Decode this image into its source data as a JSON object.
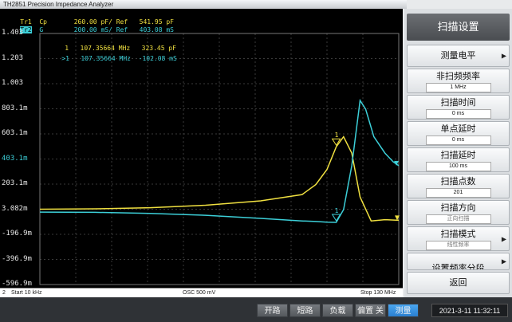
{
  "app": {
    "title": "TH2851 Precision Impedance Analyzer"
  },
  "traces": {
    "tr1": {
      "name": "Tr1",
      "param": "Cp",
      "value": "260.00",
      "unit": "pF/",
      "ref_label": "Ref",
      "ref": "541.95 pF",
      "color": "#f0e040"
    },
    "tr2": {
      "name": "Tr2",
      "param": "G",
      "value": "200.00",
      "unit": "mS/",
      "ref_label": "Ref",
      "ref": "403.08 mS",
      "color": "#3ccfd8"
    }
  },
  "markers": {
    "m1": {
      "id": "1",
      "freq": "107.35664 MHz",
      "value": "323.45 pF"
    },
    "m2": {
      "id": ">1",
      "freq": "107.35664 MHz",
      "value": "-102.08 mS"
    }
  },
  "y_labels": [
    "1.403",
    "1.203",
    "1.003",
    "803.1m",
    "603.1m",
    "403.1m",
    "203.1m",
    "3.082m",
    "-196.9m",
    "-396.9m",
    "-596.9m"
  ],
  "status": {
    "channel": "2",
    "start": "Start 10 kHz",
    "osc": "OSC 500 mV",
    "stop": "Stop 130 MHz"
  },
  "sidebar": {
    "title": "扫描设置",
    "items": [
      {
        "label": "测量电平",
        "value": null
      },
      {
        "label": "非扫频频率",
        "value": "1 MHz"
      },
      {
        "label": "扫描时间",
        "value": "0 ms"
      },
      {
        "label": "单点延时",
        "value": "0 ms"
      },
      {
        "label": "扫描延时",
        "value": "100 ms"
      },
      {
        "label": "扫描点数",
        "value": "201"
      },
      {
        "label": "扫描方向",
        "value": "正向扫描"
      },
      {
        "label": "扫描模式",
        "value": "线性频率"
      },
      {
        "label": "设置频率分段",
        "value": null
      },
      {
        "label": "返回",
        "value": null
      }
    ]
  },
  "bottom": {
    "buttons": [
      "开路",
      "短路",
      "负载",
      "偏置 关",
      "测量"
    ],
    "active": "测量",
    "datetime": "2021-3-11 11:32:11"
  },
  "chart_data": {
    "type": "line",
    "x_range_mhz": [
      0.01,
      130
    ],
    "ylim": [
      -0.5969,
      1.403
    ],
    "series": [
      {
        "name": "Tr1",
        "x": [
          0.01,
          20,
          40,
          60,
          80,
          95,
          100,
          104,
          107.36,
          110,
          113,
          116,
          120,
          125,
          130
        ],
        "y": [
          0.003,
          0.006,
          0.015,
          0.035,
          0.07,
          0.12,
          0.2,
          0.32,
          0.5,
          0.58,
          0.45,
          0.1,
          -0.09,
          -0.08,
          -0.085
        ]
      },
      {
        "name": "Tr2",
        "x": [
          0.01,
          20,
          40,
          60,
          80,
          95,
          100,
          104,
          107.36,
          110,
          113,
          116,
          118,
          121,
          125,
          128,
          130
        ],
        "y": [
          -0.02,
          -0.022,
          -0.03,
          -0.045,
          -0.07,
          -0.09,
          -0.095,
          -0.1,
          -0.102,
          0.0,
          0.35,
          0.87,
          0.8,
          0.58,
          0.45,
          0.38,
          0.35
        ]
      }
    ]
  }
}
